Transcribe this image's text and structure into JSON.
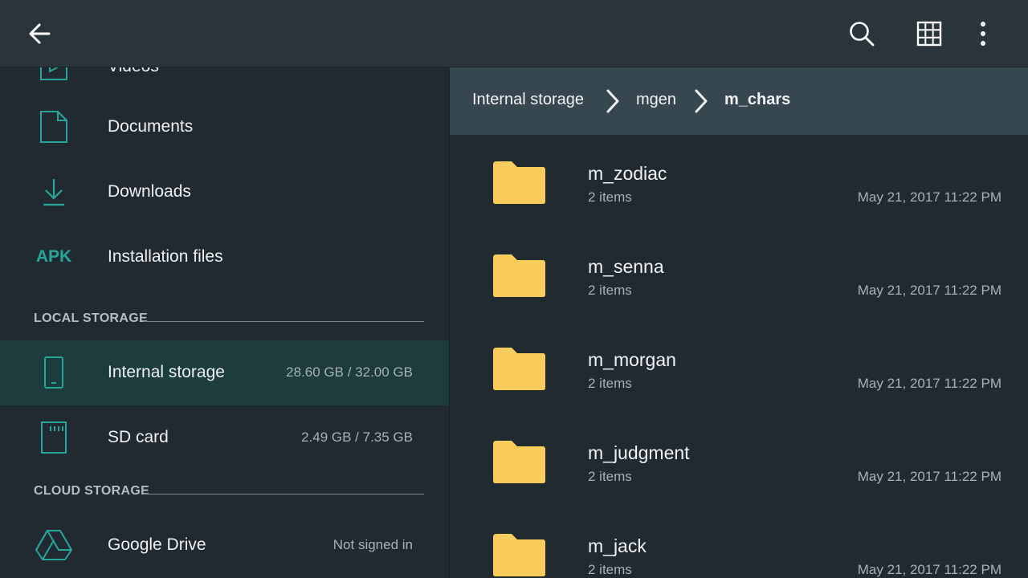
{
  "toolbar": {
    "back_icon": "arrow-back-icon",
    "search_icon": "search-icon",
    "grid_icon": "grid-view-icon",
    "more_icon": "more-vert-icon"
  },
  "sidebar": {
    "items": [
      {
        "label": "Videos",
        "icon": "video-icon"
      },
      {
        "label": "Documents",
        "icon": "document-icon"
      },
      {
        "label": "Downloads",
        "icon": "download-icon"
      },
      {
        "label": "Installation files",
        "icon": "apk-icon",
        "icon_text": "APK"
      }
    ],
    "local_storage": {
      "header": "LOCAL STORAGE",
      "items": [
        {
          "label": "Internal storage",
          "meta": "28.60 GB / 32.00 GB",
          "icon": "phone-icon",
          "active": true
        },
        {
          "label": "SD card",
          "meta": "2.49 GB / 7.35 GB",
          "icon": "sd-card-icon"
        }
      ]
    },
    "cloud_storage": {
      "header": "CLOUD STORAGE",
      "items": [
        {
          "label": "Google Drive",
          "meta": "Not signed in",
          "icon": "google-drive-icon"
        }
      ]
    }
  },
  "breadcrumb": [
    "Internal storage",
    "mgen",
    "m_chars"
  ],
  "files": [
    {
      "name": "m_zodiac",
      "count": "2 items",
      "date": "May 21, 2017 11:22 PM"
    },
    {
      "name": "m_senna",
      "count": "2 items",
      "date": "May 21, 2017 11:22 PM"
    },
    {
      "name": "m_morgan",
      "count": "2 items",
      "date": "May 21, 2017 11:22 PM"
    },
    {
      "name": "m_judgment",
      "count": "2 items",
      "date": "May 21, 2017 11:22 PM"
    },
    {
      "name": "m_jack",
      "count": "2 items",
      "date": "May 21, 2017 11:22 PM"
    }
  ],
  "colors": {
    "accent": "#26a69a",
    "folder": "#f9cc5c",
    "topbar": "#29343b",
    "breadcrumb_bg": "#37474f",
    "active_row": "#1c3c3e"
  }
}
